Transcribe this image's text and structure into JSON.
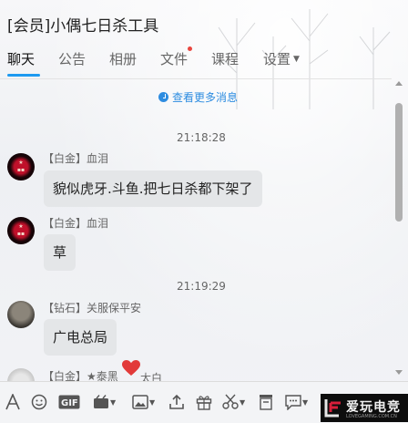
{
  "window": {
    "title": "[会员]小偶七日杀工具"
  },
  "tabs": [
    {
      "label": "聊天",
      "active": true
    },
    {
      "label": "公告"
    },
    {
      "label": "相册"
    },
    {
      "label": "文件",
      "has_notification_dot": true
    },
    {
      "label": "课程"
    },
    {
      "label": "设置",
      "has_dropdown": true
    }
  ],
  "chat": {
    "load_more": "查看更多消息",
    "messages": [
      {
        "time": "21:18:28",
        "sender": "【白金】血泪",
        "text": "貌似虎牙.斗鱼.把七日杀都下架了",
        "avatar": "dark-red-avatar"
      },
      {
        "sender": "【白金】血泪",
        "text": "草",
        "avatar": "dark-red-avatar"
      },
      {
        "time": "21:19:29",
        "sender": "【钻石】关服保平安",
        "text": "广电总局",
        "avatar": "grey-avatar"
      },
      {
        "sender": "【白金】★泰黑",
        "sender_suffix": "太白",
        "text": "",
        "avatar": "light-avatar"
      }
    ]
  },
  "toolbar": {
    "items": [
      "font-icon",
      "emoji-icon",
      "gif-icon",
      "video-icon",
      "image-icon",
      "upload-icon",
      "gift-icon",
      "scissors-icon",
      "bookmark-icon",
      "chat-icon"
    ]
  },
  "watermark": {
    "text": "爱玩电竞",
    "sub": "LOVEGAMING.COM.CN"
  },
  "colors": {
    "accent": "#1e9af0",
    "link": "#2d8ce0",
    "dot": "#e9463f"
  }
}
